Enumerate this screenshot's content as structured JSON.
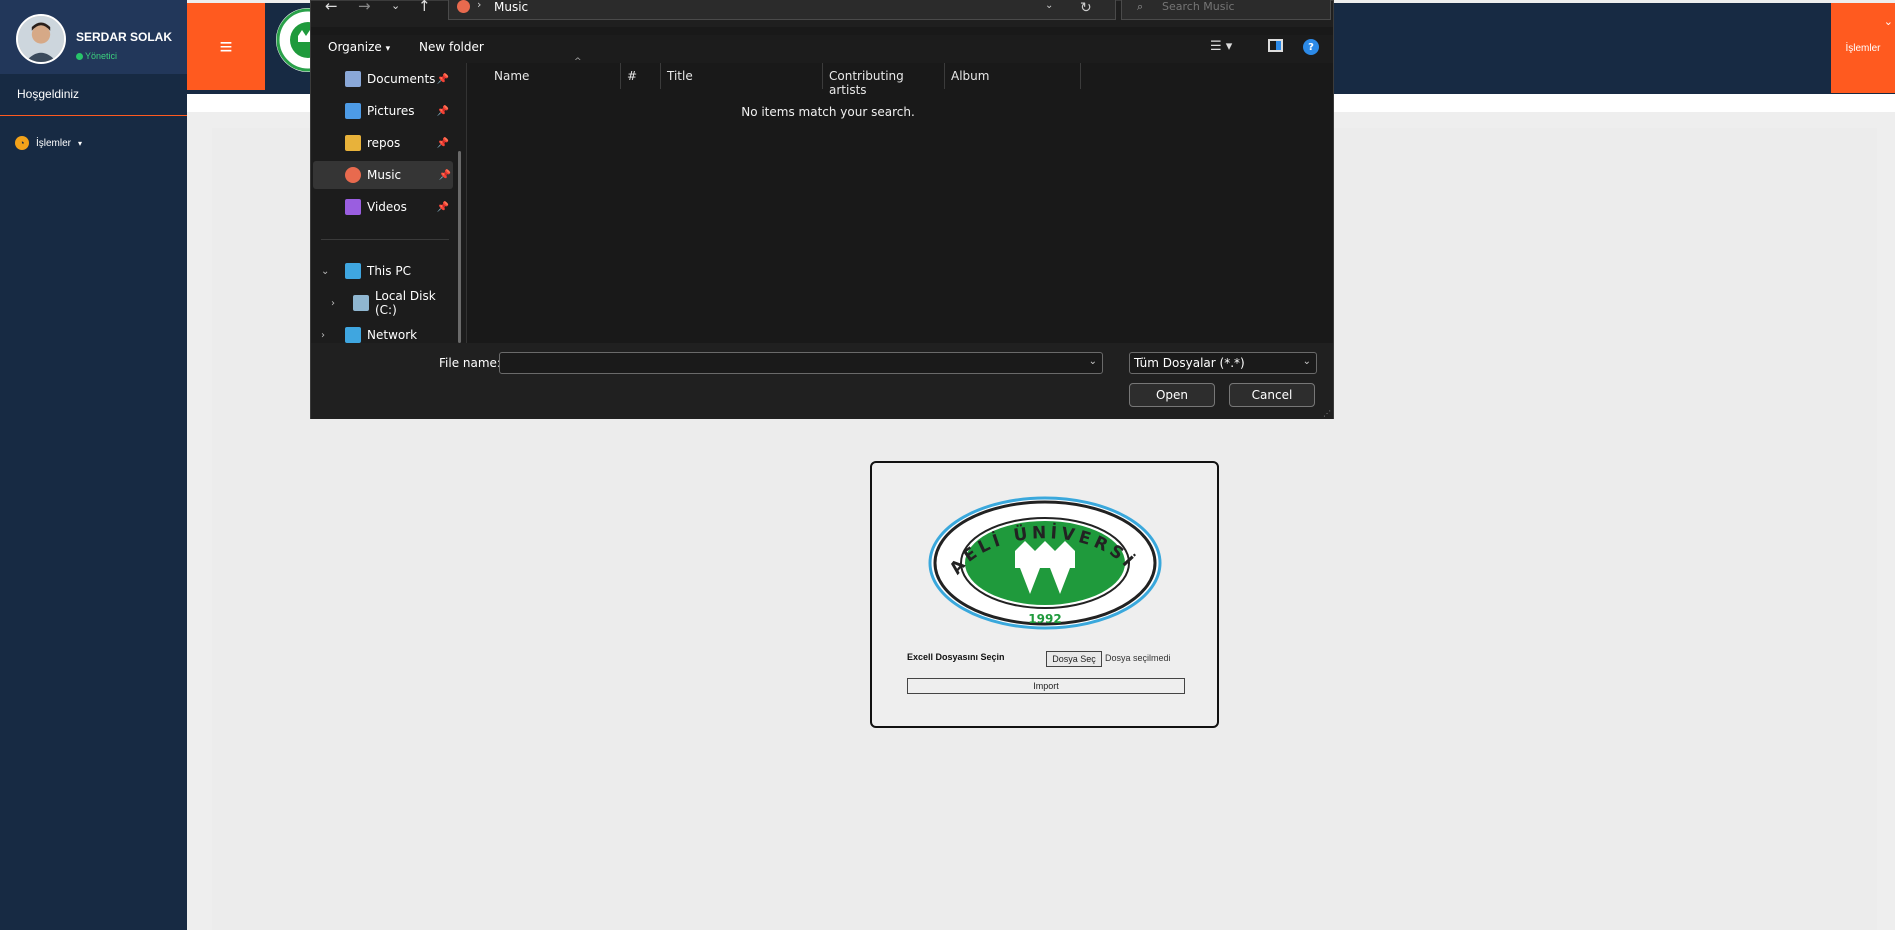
{
  "sidebar": {
    "user_name": "SERDAR SOLAK",
    "user_role": "Yönetici",
    "welcome": "Hoşgeldiniz",
    "menu_label": "İşlemler"
  },
  "topbar": {
    "right_label": "İşlemler"
  },
  "upload_card": {
    "file_label": "Excell Dosyasını Seçin",
    "choose_button": "Dosya Seç",
    "no_file_text": "Dosya seçilmedi",
    "import_button": "Import",
    "logo_text": "KOCAELİ ÜNİVERSİTESİ",
    "logo_year": "1992"
  },
  "file_dialog": {
    "current_folder": "Music",
    "search_placeholder": "Search Music",
    "organize_label": "Organize",
    "new_folder_label": "New folder",
    "nav_items": [
      {
        "label": "Documents",
        "color": "#8aa8d8",
        "pinned": true
      },
      {
        "label": "Pictures",
        "color": "#4d9be6",
        "pinned": true
      },
      {
        "label": "repos",
        "color": "#e8b23a",
        "pinned": true
      },
      {
        "label": "Music",
        "color": "#e86a4e",
        "pinned": true,
        "selected": true
      },
      {
        "label": "Videos",
        "color": "#9a5ee0",
        "pinned": true
      }
    ],
    "this_pc": "This PC",
    "local_disk": "Local Disk (C:)",
    "network": "Network",
    "columns": [
      "Name",
      "#",
      "Title",
      "Contributing artists",
      "Album"
    ],
    "empty_message": "No items match your search.",
    "file_name_label": "File name:",
    "file_name_value": "",
    "filter_value": "Tüm Dosyalar (*.*)",
    "open_button": "Open",
    "cancel_button": "Cancel"
  },
  "colors": {
    "accent_orange": "#ff5a1f",
    "navy": "#172a43",
    "dialog_bg": "#191919"
  }
}
